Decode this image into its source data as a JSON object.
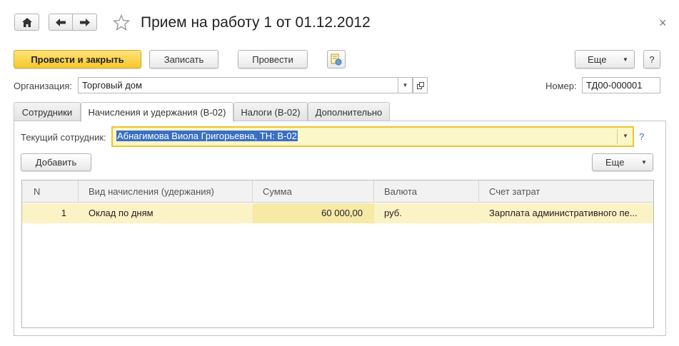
{
  "window": {
    "title": "Прием на работу 1 от 01.12.2012",
    "close_glyph": "×"
  },
  "nav": {
    "home_icon": "home-icon",
    "back_icon": "arrow-left-icon",
    "forward_icon": "arrow-right-icon",
    "favorite_icon": "star-icon"
  },
  "toolbar": {
    "post_and_close": "Провести и закрыть",
    "save": "Записать",
    "post": "Провести",
    "more": "Еще",
    "help": "?"
  },
  "header": {
    "organization_label": "Организация:",
    "organization_value": "Торговый дом",
    "number_label": "Номер:",
    "number_value": "ТД00-000001"
  },
  "tabs": [
    {
      "label": "Сотрудники",
      "active": false
    },
    {
      "label": "Начисления и удержания (В-02)",
      "active": true
    },
    {
      "label": "Налоги (В-02)",
      "active": false
    },
    {
      "label": "Дополнительно",
      "active": false
    }
  ],
  "accruals": {
    "current_employee_label": "Текущий сотрудник:",
    "current_employee_value": "Абнагимова Виола Григорьевна, ТН: В-02",
    "help": "?",
    "add_button": "Добавить",
    "more_button": "Еще",
    "columns": [
      "N",
      "Вид начисления (удержания)",
      "Сумма",
      "Валюта",
      "Счет затрат"
    ],
    "rows": [
      {
        "n": "1",
        "type": "Оклад по дням",
        "amount": "60 000,00",
        "currency": "руб.",
        "account": "Зарплата административного пе..."
      }
    ]
  },
  "colors": {
    "accent_yellow": "#f7c82c",
    "selected_row": "#fbf2c5",
    "focused_field": "#fbf7c7",
    "selection_blue": "#3a6fc4"
  }
}
